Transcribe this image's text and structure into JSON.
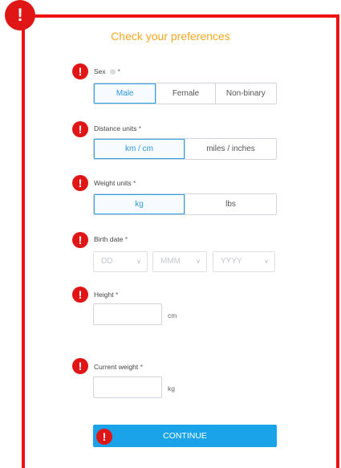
{
  "title": "Check your preferences",
  "required_mark": "*",
  "alert_glyph": "!",
  "colors": {
    "accent": "#1aa3e8",
    "title": "#f5a623",
    "alert": "#e01616",
    "frame": "#ee1111"
  },
  "sex": {
    "label": "Sex",
    "options": [
      "Male",
      "Female",
      "Non-binary"
    ],
    "selected": "Male"
  },
  "distance": {
    "label": "Distance units",
    "options": [
      "km / cm",
      "miles / inches"
    ],
    "selected": "km / cm"
  },
  "weight_units": {
    "label": "Weight units",
    "options": [
      "kg",
      "lbs"
    ],
    "selected": "kg"
  },
  "birth": {
    "label": "Birth date",
    "day": "DD",
    "month": "MMM",
    "year": "YYYY"
  },
  "height": {
    "label": "Height",
    "unit": "cm",
    "value": ""
  },
  "current_weight": {
    "label": "Current weight",
    "unit": "kg",
    "value": ""
  },
  "continue_label": "CONTINUE"
}
